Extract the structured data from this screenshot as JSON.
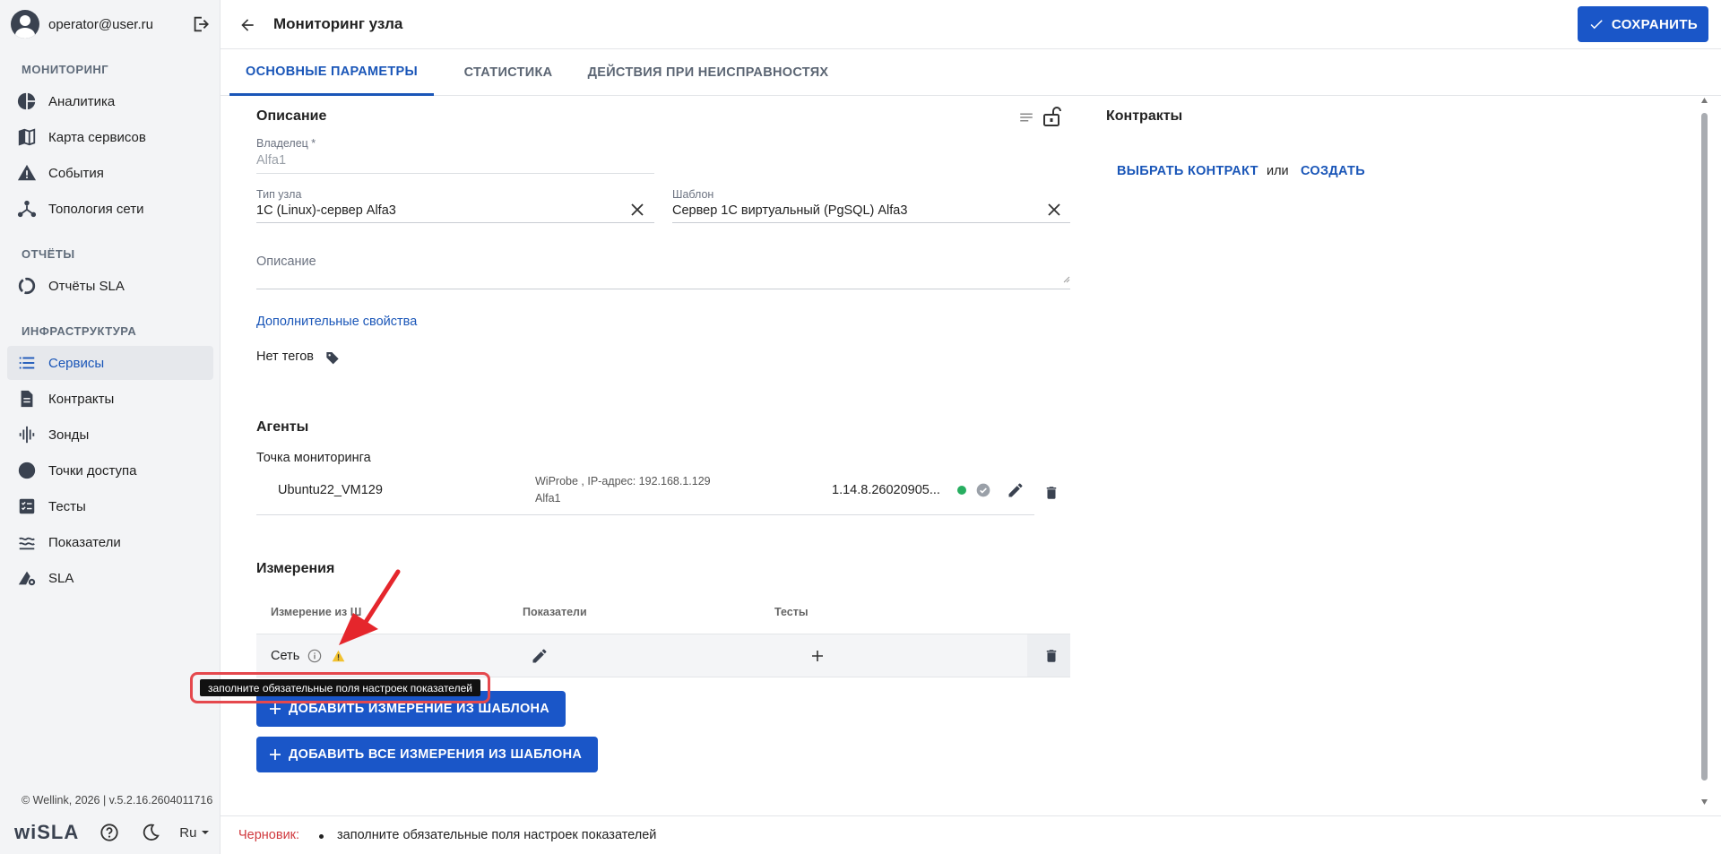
{
  "sidebar": {
    "user_email": "operator@user.ru",
    "sections": {
      "monitoring": "МОНИТОРИНГ",
      "reports": "ОТЧЁТЫ",
      "infrastructure": "ИНФРАСТРУКТУРА"
    },
    "items": {
      "analytics": "Аналитика",
      "service_map": "Карта сервисов",
      "events": "События",
      "topology": "Топология сети",
      "sla_reports": "Отчёты SLA",
      "services": "Сервисы",
      "contracts": "Контракты",
      "probes": "Зонды",
      "access_points": "Точки доступа",
      "tests": "Тесты",
      "indicators": "Показатели",
      "sla": "SLA"
    },
    "copyright": "© Wellink, 2026 | v.5.2.16.2604011716",
    "brand_prefix": "wi",
    "brand_suffix": "SLA",
    "language": "Ru"
  },
  "header": {
    "title": "Мониторинг узла",
    "save_label": "СОХРАНИТЬ"
  },
  "tabs": {
    "main": "ОСНОВНЫЕ ПАРАМЕТРЫ",
    "stats": "СТАТИСТИКА",
    "faults": "ДЕЙСТВИЯ ПРИ НЕИСПРАВНОСТЯХ"
  },
  "description": {
    "title": "Описание",
    "owner_label": "Владелец *",
    "owner_value": "Alfa1",
    "node_type_label": "Тип узла",
    "node_type_value": "1С (Linux)-сервер Alfa3",
    "template_label": "Шаблон",
    "template_value": "Сервер 1С виртуальный (PgSQL) Alfa3",
    "description_placeholder": "Описание",
    "extra_props_link": "Дополнительные свойства",
    "no_tags": "Нет тегов"
  },
  "contracts": {
    "title": "Контракты",
    "choose_link": "ВЫБРАТЬ КОНТРАКТ",
    "or_text": "или",
    "create_link": "СОЗДАТЬ"
  },
  "agents": {
    "title": "Агенты",
    "monitoring_point_label": "Точка мониторинга",
    "agent_name": "Ubuntu22_VM129",
    "agent_info_line1": "WiProbe , IP-адрес: 192.168.1.129",
    "agent_info_line2": "Alfa1",
    "agent_version": "1.14.8.26020905...",
    "status_color": "#27ae60"
  },
  "measurements": {
    "title": "Измерения",
    "col_measurement": "Измерение из Ш",
    "col_indicators": "Показатели",
    "col_tests": "Тесты",
    "row_name": "Сеть",
    "tooltip": "заполните обязательные поля настроек показателей",
    "add_from_template": "ДОБАВИТЬ ИЗМЕРЕНИЕ ИЗ ШАБЛОНА",
    "add_all_from_template": "ДОБАВИТЬ ВСЕ ИЗМЕРЕНИЯ ИЗ ШАБЛОНА"
  },
  "footer": {
    "draft_label": "Черновик:",
    "draft_message": "заполните обязательные поля настроек показателей"
  },
  "colors": {
    "primary": "#1a56c8",
    "warning": "#f2c230",
    "error": "#e5484d"
  }
}
